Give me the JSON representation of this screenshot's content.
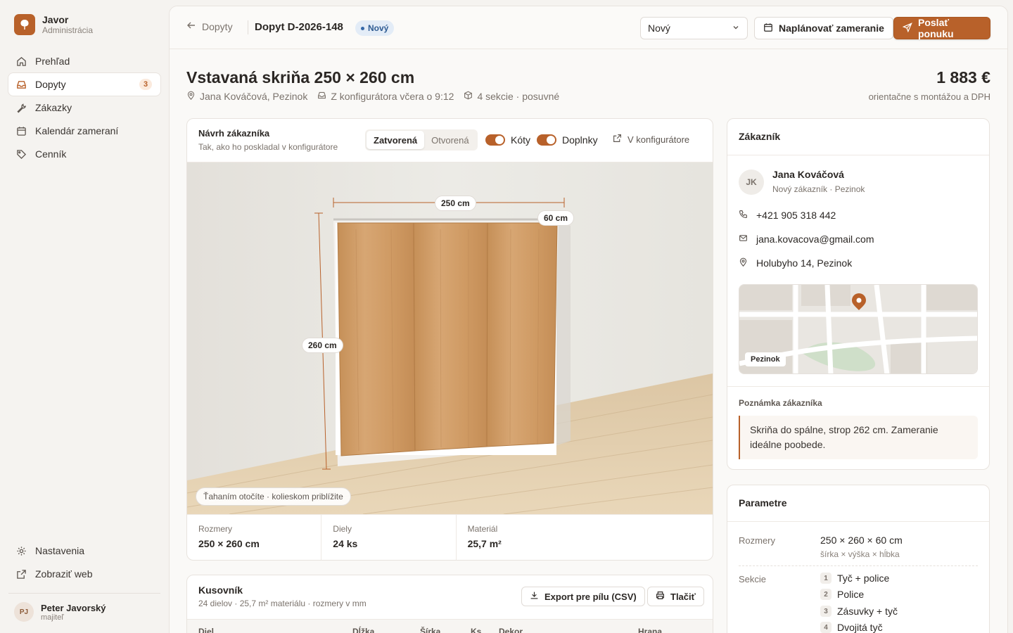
{
  "brand": {
    "name": "Javor",
    "sub": "Administrácia"
  },
  "nav": [
    {
      "label": "Prehľad",
      "icon": "home-icon"
    },
    {
      "label": "Dopyty",
      "icon": "inbox-icon",
      "badge": "3",
      "active": true
    },
    {
      "label": "Zákazky",
      "icon": "wrench-icon"
    },
    {
      "label": "Kalendár zameraní",
      "icon": "calendar-icon"
    },
    {
      "label": "Cenník",
      "icon": "tag-icon"
    }
  ],
  "nav_bottom": [
    {
      "label": "Nastavenia",
      "icon": "gear-icon"
    },
    {
      "label": "Zobraziť web",
      "icon": "external-link-icon"
    }
  ],
  "user": {
    "initials": "PJ",
    "name": "Peter Javorský",
    "role": "majiteľ"
  },
  "topbar": {
    "back": "Dopyty",
    "title": "Dopyt D-2026-148",
    "badge": "Nový",
    "status_select": "Nový",
    "schedule_btn": "Naplánovať zameranie",
    "send_btn": "Poslať ponuku"
  },
  "header": {
    "title": "Vstavaná skriňa 250 × 260 cm",
    "meta_customer": "Jana Kováčová, Pezinok",
    "meta_source": "Z konfigurátora včera o 9:12",
    "meta_sections": "4 sekcie · posuvné",
    "price": "1 883 €",
    "price_sub": "orientačne s montážou a DPH"
  },
  "design": {
    "title": "Návrh zákazníka",
    "sub": "Tak, ako ho poskladal v konfigurátore",
    "seg_closed": "Zatvorená",
    "seg_open": "Otvorená",
    "toggle_dims": "Kóty",
    "toggle_extras": "Doplnky",
    "open_config": "V konfigurátore",
    "dim_width": "250 cm",
    "dim_depth": "60 cm",
    "dim_height": "260 cm",
    "hint": "Ťahaním otočíte · kolieskom priblížite",
    "stats": [
      {
        "label": "Rozmery",
        "value": "250 × 260 cm"
      },
      {
        "label": "Diely",
        "value": "24 ks"
      },
      {
        "label": "Materiál",
        "value": "25,7 m²"
      }
    ]
  },
  "kusovnik": {
    "title": "Kusovník",
    "sub": "24 dielov · 25,7 m² materiálu · rozmery v mm",
    "export_btn": "Export pre pílu (CSV)",
    "print_btn": "Tlačiť",
    "columns": [
      "Diel",
      "Dĺžka",
      "Šírka",
      "Ks",
      "Dekor",
      "Hrana"
    ]
  },
  "customer": {
    "title": "Zákazník",
    "initials": "JK",
    "name": "Jana Kováčová",
    "sub": "Nový zákazník · Pezinok",
    "phone": "+421 905 318 442",
    "email": "jana.kovacova@gmail.com",
    "address": "Holubyho 14, Pezinok",
    "map_label": "Pezinok",
    "note_label": "Poznámka zákazníka",
    "note": "Skriňa do spálne, strop 262 cm. Zameranie ideálne poobede."
  },
  "params": {
    "title": "Parametre",
    "dims_label": "Rozmery",
    "dims_value": "250 × 260 × 60 cm",
    "dims_hint": "šírka × výška × hĺbka",
    "sections_label": "Sekcie",
    "sections": [
      {
        "n": "1",
        "label": "Tyč + police"
      },
      {
        "n": "2",
        "label": "Police"
      },
      {
        "n": "3",
        "label": "Zásuvky + tyč"
      },
      {
        "n": "4",
        "label": "Dvojitá tyč"
      }
    ]
  },
  "colors": {
    "accent": "#b8612a",
    "badge_blue": "#2f5c93"
  }
}
